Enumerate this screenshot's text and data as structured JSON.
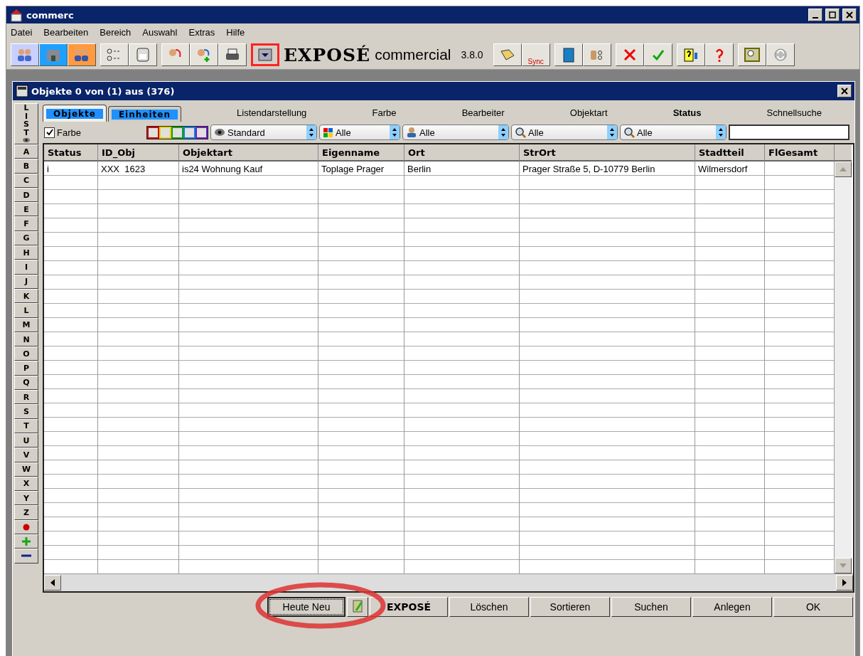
{
  "window": {
    "title": "commerc"
  },
  "menu": [
    "Datei",
    "Bearbeiten",
    "Bereich",
    "Auswahl",
    "Extras",
    "Hilfe"
  ],
  "toolbar": {
    "logo": "EXPOSÉ",
    "product": "commercial",
    "version": "3.8.0",
    "sync_label": "Sync"
  },
  "list_window": {
    "title": "Objekte 0 von (1) aus (376)",
    "tabs": [
      {
        "label": "Objekte",
        "selected": true
      },
      {
        "label": "Einheiten",
        "selected": false
      }
    ],
    "filter_labels": [
      {
        "label": "Listendarstellung",
        "bold": false
      },
      {
        "label": "Farbe",
        "bold": false
      },
      {
        "label": "Bearbeiter",
        "bold": false
      },
      {
        "label": "Objektart",
        "bold": false
      },
      {
        "label": "Status",
        "bold": true
      },
      {
        "label": "Schnellsuche",
        "bold": false
      }
    ],
    "color_checkbox": {
      "label": "Farbe",
      "checked": true
    },
    "color_filters": [
      {
        "color": "#d00000"
      },
      {
        "color": "#e8d000"
      },
      {
        "color": "#10a010"
      },
      {
        "color": "#1080e0"
      },
      {
        "color": "#7020c0"
      }
    ],
    "dropdowns": [
      {
        "kind": "eye",
        "value": "Standard"
      },
      {
        "kind": "colors",
        "value": "Alle"
      },
      {
        "kind": "person",
        "value": "Alle"
      },
      {
        "kind": "search",
        "value": "Alle"
      },
      {
        "kind": "search",
        "value": "Alle"
      }
    ],
    "index_label": "LIST",
    "letters": [
      "A",
      "B",
      "C",
      "D",
      "E",
      "F",
      "G",
      "H",
      "I",
      "J",
      "K",
      "L",
      "M",
      "N",
      "O",
      "P",
      "Q",
      "R",
      "S",
      "T",
      "U",
      "V",
      "W",
      "X",
      "Y",
      "Z"
    ],
    "table": {
      "columns": [
        "Status",
        "ID_Obj",
        "Objektart",
        "Eigenname",
        "Ort",
        "StrOrt",
        "Stadtteil",
        "FlGesamt"
      ],
      "rows": [
        [
          "i",
          "XXX  1623",
          "is24 Wohnung Kauf",
          "Toplage Prager",
          "Berlin",
          "Prager Straße 5, D-10779 Berlin",
          "Wilmersdorf",
          ""
        ]
      ]
    },
    "buttons": [
      {
        "kind": "focus",
        "label": "Heute Neu"
      },
      {
        "kind": "icon"
      },
      {
        "kind": "bold",
        "label": "EXPOSÉ"
      },
      {
        "kind": "plain",
        "label": "Löschen"
      },
      {
        "kind": "plain",
        "label": "Sortieren"
      },
      {
        "kind": "plain",
        "label": "Suchen"
      },
      {
        "kind": "plain",
        "label": "Anlegen"
      },
      {
        "kind": "plain",
        "label": "OK"
      }
    ]
  }
}
